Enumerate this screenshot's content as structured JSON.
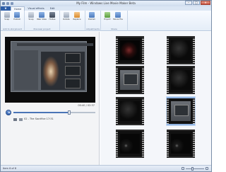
{
  "window": {
    "title": "My Film - Windows Live Movie Maker Beta",
    "minimize": "–",
    "maximize": "□",
    "close": "✕"
  },
  "tabs": [
    {
      "label": "Home"
    },
    {
      "label": "Visual effects"
    },
    {
      "label": "Edit"
    }
  ],
  "file_tab": "▼",
  "ribbon": {
    "groups": [
      {
        "label": "Add to storyboard",
        "buttons": [
          "Snap",
          "Publish"
        ]
      },
      {
        "label": "Preview/ project",
        "buttons": [
          "Snap",
          "Web Sites",
          "Hi-Res"
        ]
      },
      {
        "label": "",
        "buttons": [
          "Rotate",
          "Replace"
        ]
      },
      {
        "label": "Adjustments",
        "buttons": [
          "Publish"
        ]
      },
      {
        "label": "Share",
        "buttons": [
          "Export",
          "Movie File"
        ]
      }
    ]
  },
  "preview": {
    "time": "00:40 / 02:37",
    "seek_fraction": 0.68,
    "clip_label": "02 - The Sacrifice  17:31"
  },
  "storyboard": {
    "clip_count": 8,
    "selected_index": 5
  },
  "status": {
    "text": "Item 6 of 8"
  },
  "zoom": {
    "level_fraction": 0.35
  }
}
